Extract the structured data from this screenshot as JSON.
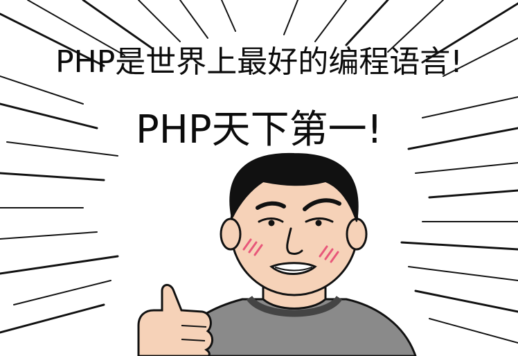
{
  "caption": {
    "line1": "PHP是世界上最好的编程语言!",
    "line2": "PHP天下第一!"
  },
  "colors": {
    "ink": "#0b0b0b",
    "skin": "#f6d2b8",
    "shirt": "#8a8a8a",
    "blush": "#e8577a"
  }
}
